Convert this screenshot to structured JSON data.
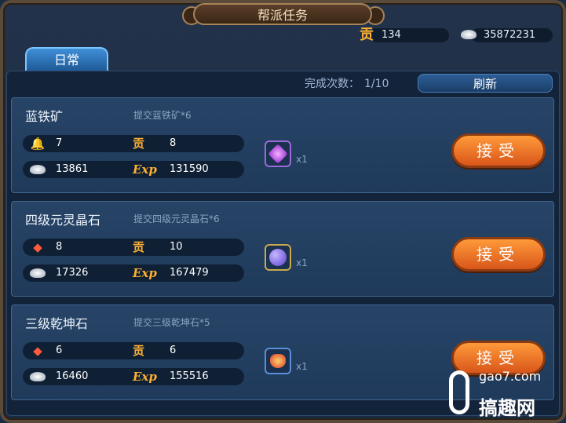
{
  "header": {
    "title": "帮派任务"
  },
  "resources": {
    "contribution": "134",
    "silver": "35872231",
    "contribution_icon": "贡"
  },
  "tabs": [
    {
      "label": "日常"
    }
  ],
  "progress": {
    "label": "完成次数：",
    "value": "1/10"
  },
  "refresh_label": "刷新",
  "tasks": [
    {
      "name": "蓝铁矿",
      "desc": "提交蓝铁矿*6",
      "reward_a": "7",
      "contribution": "8",
      "silver": "13861",
      "exp": "131590",
      "item_qty": "x1",
      "accept_label": "接受",
      "item_icon": "purple-gem-icon"
    },
    {
      "name": "四级元灵晶石",
      "desc": "提交四级元灵晶石*6",
      "reward_a": "8",
      "contribution": "10",
      "silver": "17326",
      "exp": "167479",
      "item_qty": "x1",
      "accept_label": "接受",
      "item_icon": "grape-crystal-icon"
    },
    {
      "name": "三级乾坤石",
      "desc": "提交三级乾坤石*5",
      "reward_a": "6",
      "contribution": "6",
      "silver": "16460",
      "exp": "155516",
      "item_qty": "x1",
      "accept_label": "接受",
      "item_icon": "gift-pouch-icon"
    }
  ],
  "exp_label": "Exp",
  "watermark": {
    "site": "gao7.com",
    "name": "搞趣网"
  }
}
